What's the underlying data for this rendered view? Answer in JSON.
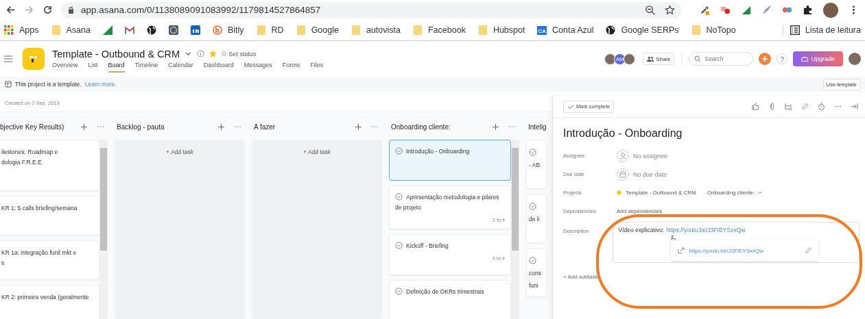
{
  "browser": {
    "url": "app.asana.com/0/1138089091083992/1179814527864857",
    "bookmarks": [
      {
        "kind": "grid",
        "label": "Apps"
      },
      {
        "kind": "folder",
        "label": "Asana"
      },
      {
        "kind": "triangle"
      },
      {
        "kind": "mail"
      },
      {
        "kind": "globe"
      },
      {
        "kind": "badge"
      },
      {
        "kind": "linkedin"
      },
      {
        "kind": "bitly",
        "label": "Bitly"
      },
      {
        "kind": "folder",
        "label": "RD"
      },
      {
        "kind": "folder",
        "label": "Google"
      },
      {
        "kind": "folder",
        "label": "autovista"
      },
      {
        "kind": "folder",
        "label": "Facebook"
      },
      {
        "kind": "folder",
        "label": "Hubspot"
      },
      {
        "kind": "ca",
        "icon_text": "CA",
        "label": "Conta Azul"
      },
      {
        "kind": "globe",
        "label": "Google SERPs"
      },
      {
        "kind": "folder",
        "label": "NoTopo"
      }
    ],
    "reading_list": "Lista de leitura"
  },
  "project": {
    "title": "Template - Outbound & CRM",
    "starred": true,
    "status": "Set status",
    "tabs": [
      {
        "label": "Overview",
        "selected": false
      },
      {
        "label": "List",
        "selected": false
      },
      {
        "label": "Board",
        "selected": true
      },
      {
        "label": "Timeline",
        "selected": false
      },
      {
        "label": "Calendar",
        "selected": false
      },
      {
        "label": "Dashboard",
        "selected": false
      },
      {
        "label": "Messages",
        "selected": false
      },
      {
        "label": "Forms",
        "selected": false
      },
      {
        "label": "Files",
        "selected": false
      }
    ],
    "members": [
      {
        "kind": "photo"
      },
      {
        "kind": "initials",
        "initials": "AM"
      },
      {
        "kind": "photo"
      }
    ],
    "share": "Share",
    "search": {
      "placeholder": "Search"
    },
    "upgrade": "Upgrade"
  },
  "banner": {
    "text": "This project is a template.",
    "link": "Learn more.",
    "button": "Use template"
  },
  "created": "Created on 2 Sep, 2019",
  "columns": [
    {
      "kind": "cards",
      "title": "bjective Key Results)",
      "menu": true,
      "scrollbar": true,
      "cards": [
        {
          "kind": "inline",
          "lines": [
            "ilestones. Roadmap e",
            "dologia F.R.E.E."
          ],
          "check": false,
          "selected": false
        },
        {
          "kind": "inline",
          "lines": [
            "KR 1: 5 calls briefing/semana"
          ],
          "check": false,
          "selected": false
        },
        {
          "kind": "inline",
          "lines": [
            "KR 1a: integração funil mkt e",
            "s"
          ],
          "check": false,
          "selected": false
        },
        {
          "kind": "inline",
          "lines": [
            "KR 2: primeira venda (geralmente"
          ],
          "check": false,
          "selected": false
        }
      ]
    },
    {
      "kind": "empty",
      "title": "Backlog - pauta",
      "menu": true,
      "add_task": "+ Add task"
    },
    {
      "kind": "empty",
      "title": "A fazer",
      "menu": true,
      "add_task": "+ Add task"
    },
    {
      "kind": "cards",
      "title": "Onboarding cliente:",
      "menu": true,
      "scrollbar": true,
      "cards": [
        {
          "kind": "inline",
          "lines": [
            "Introdução - Onboarding"
          ],
          "check": true,
          "selected": true
        },
        {
          "kind": "inline",
          "lines": [
            "Apresentação metodologia e pilares",
            "de projeto"
          ],
          "check": true,
          "subtasks": "3",
          "selected": false
        },
        {
          "kind": "inline",
          "lines": [
            "Kickoff - Briefing"
          ],
          "check": true,
          "subtasks": "4",
          "selected": false
        },
        {
          "kind": "inline",
          "lines": [
            "Definição de OKRs trimestrais"
          ],
          "check": true,
          "selected": false
        }
      ]
    },
    {
      "kind": "cards",
      "title": "Intelig",
      "menu": false,
      "scrollbar": false,
      "cards": [
        {
          "kind": "stacked",
          "lines": [
            "- AB"
          ],
          "check": true,
          "selected": false
        },
        {
          "kind": "stacked",
          "lines": [
            "de li"
          ],
          "check": true,
          "selected": false
        },
        {
          "kind": "stacked",
          "lines": [
            "cons",
            "funi"
          ],
          "check": true,
          "selected": false
        }
      ]
    }
  ],
  "task_panel": {
    "mark_complete": "Mark complete",
    "title": "Introdução - Onboarding",
    "fields": [
      {
        "kind": "assignee",
        "label": "Assignee",
        "value": "No assignee"
      },
      {
        "kind": "date",
        "label": "Due date",
        "value": "No due date"
      },
      {
        "kind": "project",
        "label": "Projects",
        "value": "Template - Outbound & CRM",
        "section": "Onboarding cliente:"
      },
      {
        "kind": "plain",
        "label": "Dependencies",
        "value": "Add dependencies"
      }
    ],
    "description": {
      "label": "Description",
      "text": "Vídeo explicativo:",
      "link": "https://youtu.be/J3FIEYSxxQw",
      "popup_link": "https://youtu.be/J3FIEYSxxQw"
    },
    "add_subtask": "+ Add subtask"
  }
}
